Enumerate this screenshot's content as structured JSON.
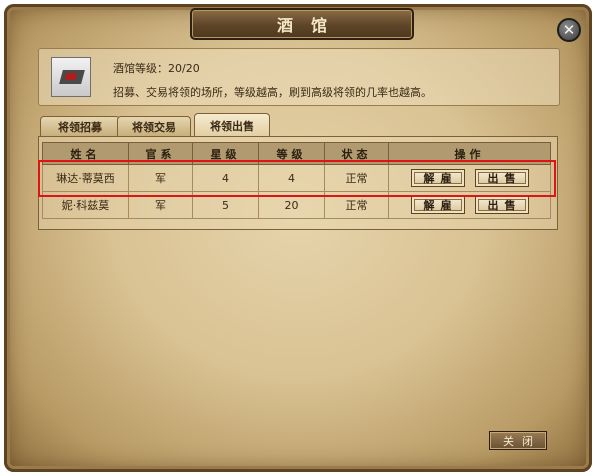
{
  "window": {
    "title": "酒馆",
    "close_icon": "close-x-icon"
  },
  "info": {
    "level_label": "酒馆等级：20/20",
    "description": "招募、交易将领的场所，等级越高，刷到高级将领的几率也越高。",
    "icon": "tavern-building-icon"
  },
  "tabs": [
    {
      "label": "将领招募",
      "active": false
    },
    {
      "label": "将领交易",
      "active": false
    },
    {
      "label": "将领出售",
      "active": true
    }
  ],
  "table": {
    "headers": [
      "姓名",
      "官系",
      "星级",
      "等级",
      "状态",
      "操作"
    ],
    "rows": [
      {
        "name": "琳达·蒂莫西",
        "branch": "军",
        "stars": "4",
        "level": "4",
        "status": "正常",
        "dismiss": "解雇",
        "sell": "出售"
      },
      {
        "name": "妮·科兹莫",
        "branch": "军",
        "stars": "5",
        "level": "20",
        "status": "正常",
        "dismiss": "解雇",
        "sell": "出售"
      }
    ]
  },
  "footer": {
    "close_label": "关闭"
  },
  "colors": {
    "highlight": "#e01414",
    "parchment": "#d9c293",
    "frame": "#5e4322"
  }
}
